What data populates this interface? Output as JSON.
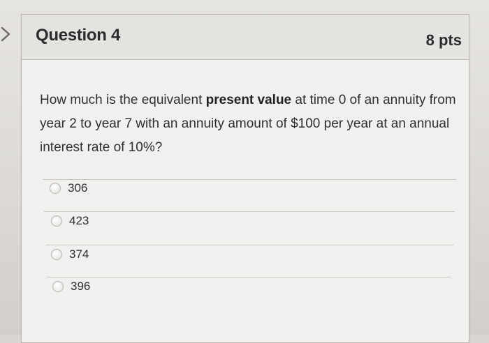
{
  "question": {
    "title": "Question 4",
    "points": "8 pts",
    "text_before": "How much is the equivalent ",
    "text_bold": "present value",
    "text_after": " at time 0 of an annuity from year 2 to year 7 with an annuity amount of $100 per year at an annual interest rate of 10%?"
  },
  "answers": [
    {
      "label": "306"
    },
    {
      "label": "423"
    },
    {
      "label": "374"
    },
    {
      "label": "396"
    }
  ],
  "icons": {
    "collapse_toggle": "chevron-right-icon",
    "radio": "radio-unchecked-icon"
  },
  "colors": {
    "card_background": "#f1f0ee",
    "header_background": "#e5e3e0",
    "text": "#2d3033"
  }
}
